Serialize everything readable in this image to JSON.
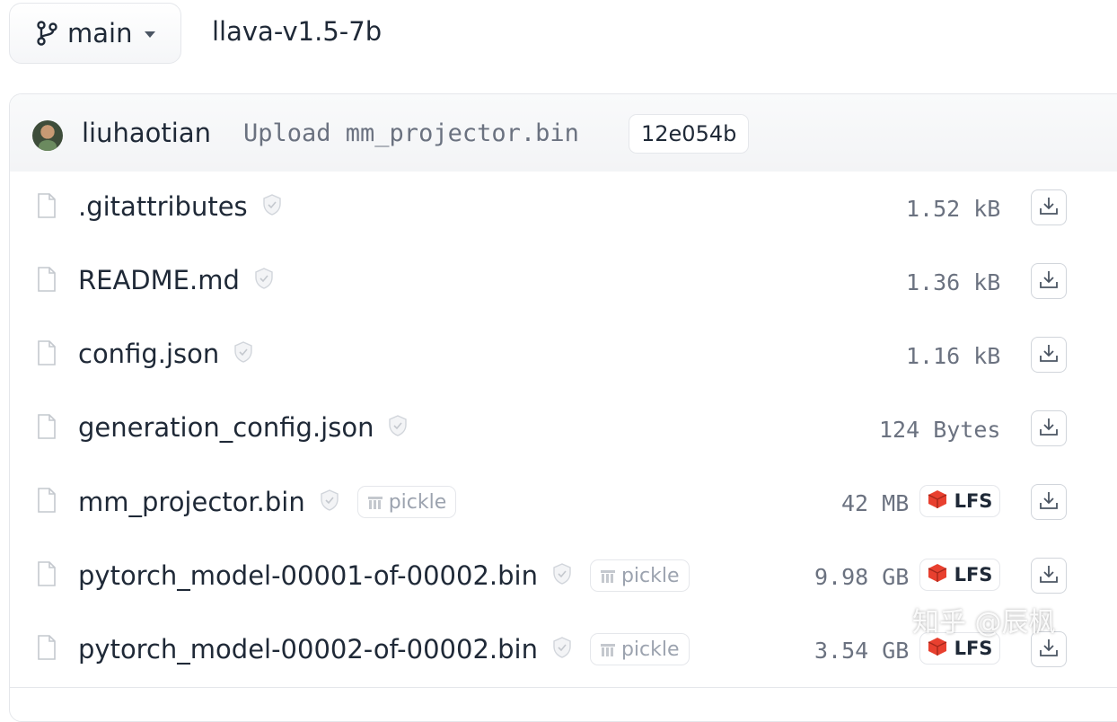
{
  "branch": {
    "name": "main",
    "icon": "git-branch-icon"
  },
  "repo": {
    "name": "llava-v1.5-7b"
  },
  "commit": {
    "user": "liuhaotian",
    "message": "Upload mm_projector.bin",
    "hash": "12e054b"
  },
  "files": [
    {
      "name": ".gitattributes",
      "size": "1.52 kB",
      "pickle": "",
      "lfs": ""
    },
    {
      "name": "README.md",
      "size": "1.36 kB",
      "pickle": "",
      "lfs": ""
    },
    {
      "name": "config.json",
      "size": "1.16 kB",
      "pickle": "",
      "lfs": ""
    },
    {
      "name": "generation_config.json",
      "size": "124 Bytes",
      "pickle": "",
      "lfs": ""
    },
    {
      "name": "mm_projector.bin",
      "size": "42 MB",
      "pickle": "pickle",
      "lfs": "LFS"
    },
    {
      "name": "pytorch_model-00001-of-00002.bin",
      "size": "9.98 GB",
      "pickle": "pickle",
      "lfs": "LFS"
    },
    {
      "name": "pytorch_model-00002-of-00002.bin",
      "size": "3.54 GB",
      "pickle": "pickle",
      "lfs": "LFS"
    }
  ],
  "watermark": "知乎 @辰枫",
  "colors": {
    "lfs_icon": "#e8402f",
    "border": "#e5e7eb",
    "muted": "#6b7280"
  }
}
